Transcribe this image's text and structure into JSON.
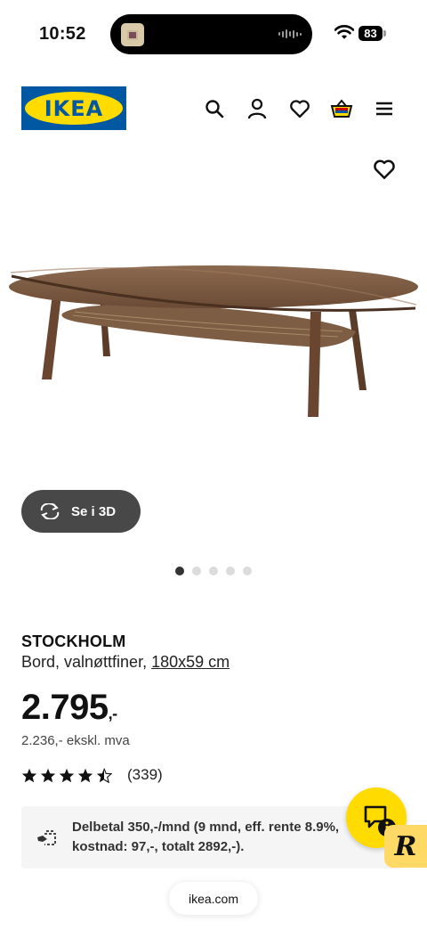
{
  "status_bar": {
    "time": "10:52",
    "battery": "83"
  },
  "header": {
    "logo_text": "IKEA",
    "icons": [
      "search-icon",
      "account-icon",
      "heart-icon",
      "cart-icon",
      "menu-icon"
    ]
  },
  "gallery": {
    "view_3d_label": "Se i 3D",
    "dots_total": 5,
    "active_dot": 1
  },
  "product": {
    "name": "STOCKHOLM",
    "description": "Bord, valnøttfiner, ",
    "size": "180x59 cm",
    "price": "2.795",
    "price_suffix": ",-",
    "price_ex_vat": "2.236,- ekskl. mva",
    "rating": 4.5,
    "rating_count": "(339)"
  },
  "finance": {
    "text": "Delbetal 350,-/mnd (9 mnd, eff. rente 8.9%, kostnad: 97,-, totalt 2892,-)."
  },
  "browser": {
    "url": "ikea.com"
  },
  "colors": {
    "ikea_blue": "#0058a3",
    "ikea_yellow": "#ffdb00",
    "button_dark": "#484848"
  }
}
